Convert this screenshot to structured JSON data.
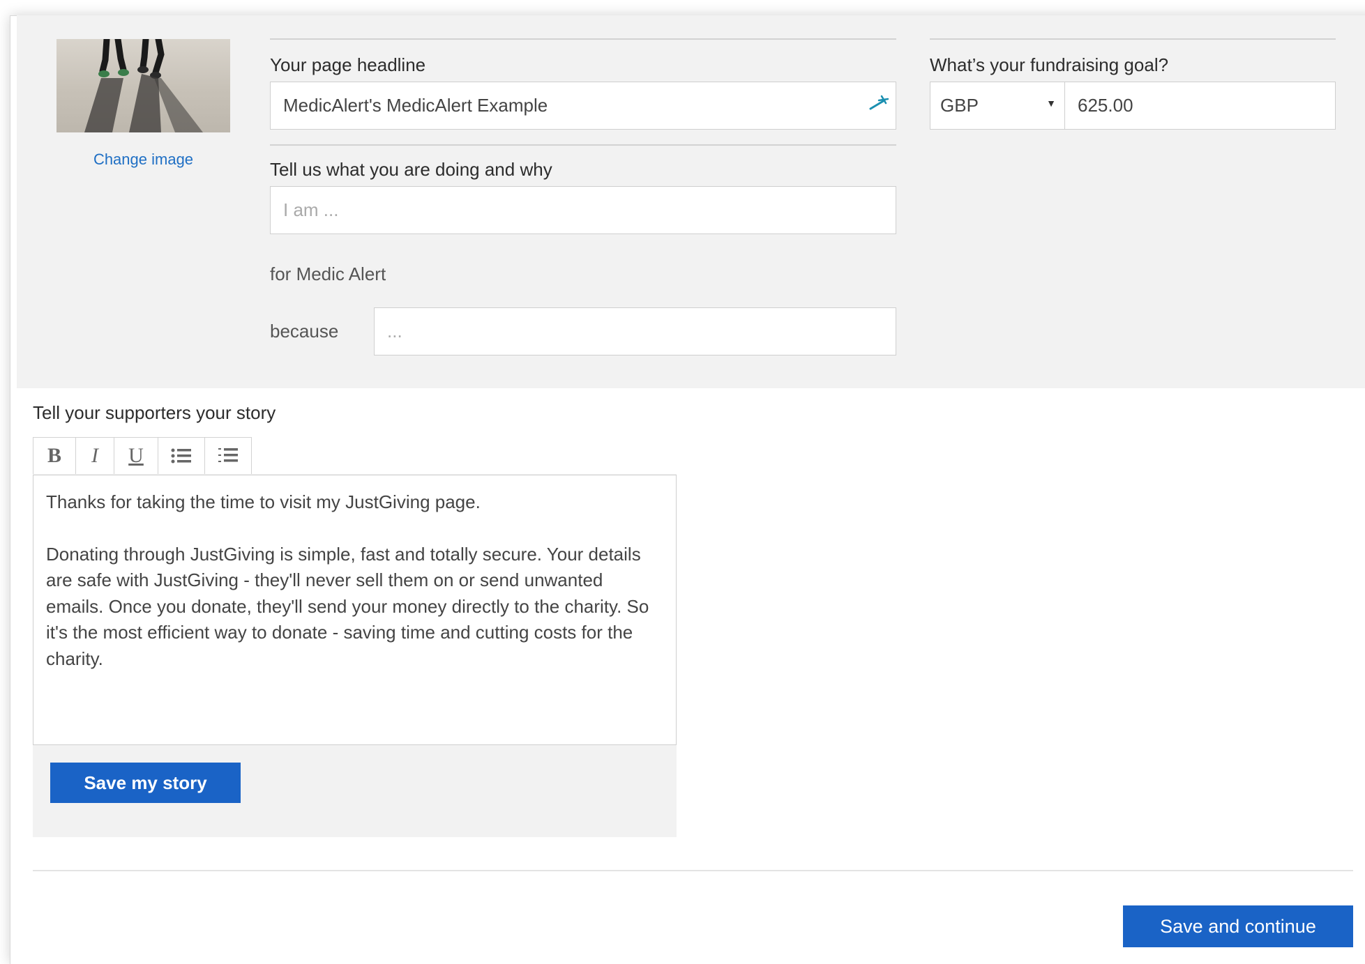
{
  "image": {
    "change_label": "Change image"
  },
  "headline": {
    "label": "Your page headline",
    "value": "MedicAlert's MedicAlert Example"
  },
  "goal": {
    "label": "What’s your fundraising goal?",
    "currency": "GBP",
    "amount": "625.00"
  },
  "doing": {
    "label": "Tell us what you are doing and why",
    "placeholder": "I am ...",
    "for_text": "for Medic Alert",
    "because_label": "because",
    "because_placeholder": "..."
  },
  "story": {
    "label": "Tell your supporters your story",
    "toolbar": {
      "bold": "B",
      "italic": "I",
      "underline": "U",
      "bullet_list_icon": "bulleted-list-icon",
      "numbered_list_icon": "numbered-list-icon"
    },
    "paragraph_1": "Thanks for taking the time to visit my JustGiving page.",
    "paragraph_2": "Donating through JustGiving is simple, fast and totally secure. Your details are safe with JustGiving - they'll never sell them on or send unwanted emails. Once you donate, they'll send your money directly to the charity. So it's the most efficient way to donate - saving time and cutting costs for the charity.",
    "save_label": "Save my story"
  },
  "footer": {
    "continue_label": "Save and continue"
  },
  "colors": {
    "accent": "#1a63c6",
    "link": "#1f6fc4",
    "panel": "#f2f2f2"
  }
}
